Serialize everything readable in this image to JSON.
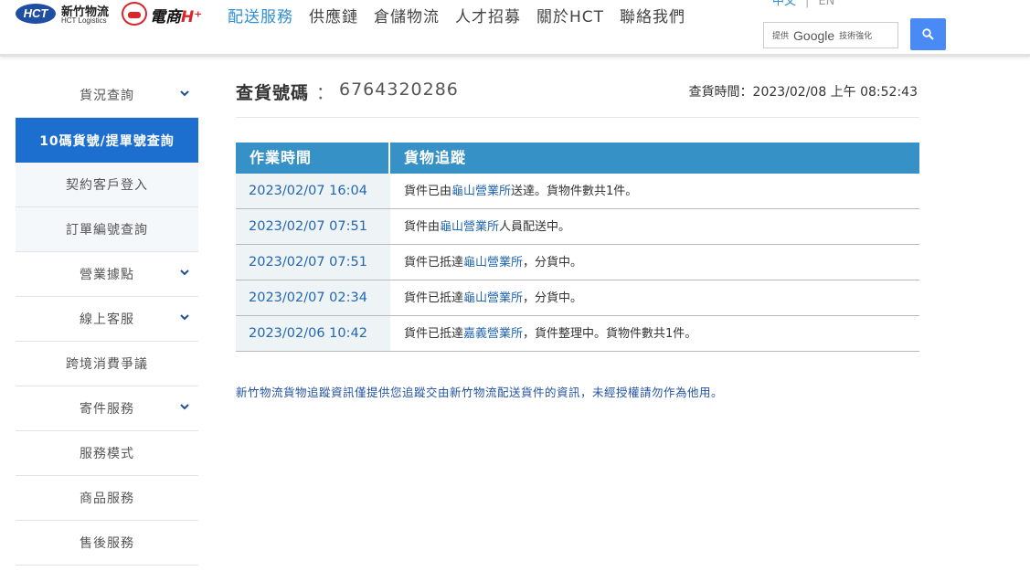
{
  "header": {
    "logo_hct": "HCT",
    "logo_cn": "新竹物流",
    "logo_en": "HCT Logistics",
    "logo_ds": "電商",
    "logo_ds_h": "H⁺",
    "nav": [
      {
        "label": "配送服務",
        "active": true
      },
      {
        "label": "供應鏈",
        "active": false
      },
      {
        "label": "倉儲物流",
        "active": false
      },
      {
        "label": "人才招募",
        "active": false
      },
      {
        "label": "關於HCT",
        "active": false
      },
      {
        "label": "聯絡我們",
        "active": false
      }
    ],
    "lang_zh": "中文",
    "lang_en": "EN",
    "search": {
      "by": "提供",
      "google": "Google",
      "tech": "技術強化"
    }
  },
  "sidebar": {
    "items": [
      {
        "label": "貨況查詢",
        "chevron": true
      },
      {
        "label": "10碼貨號/提單號查詢",
        "active": true
      },
      {
        "label": "契約客戶登入",
        "sub": true
      },
      {
        "label": "訂單編號查詢",
        "sub": true
      },
      {
        "label": "營業據點",
        "chevron": true
      },
      {
        "label": "線上客服",
        "chevron": true
      },
      {
        "label": "跨境消費爭議"
      },
      {
        "label": "寄件服務",
        "chevron": true
      },
      {
        "label": "服務模式"
      },
      {
        "label": "商品服務"
      },
      {
        "label": "售後服務"
      }
    ]
  },
  "main": {
    "title_label": "查貨號碼",
    "title_colon": "：",
    "tracking_number": "6764320286",
    "query_time": "查貨時間：2023/02/08 上午 08:52:43",
    "table": {
      "col_time": "作業時間",
      "col_track": "貨物追蹤",
      "rows": [
        {
          "time": "2023/02/07 16:04",
          "pre": "貨件已由",
          "loc": "龜山營業所",
          "post": "送達。貨物件數共1件。"
        },
        {
          "time": "2023/02/07 07:51",
          "pre": "貨件由",
          "loc": "龜山營業所",
          "post": "人員配送中。"
        },
        {
          "time": "2023/02/07 07:51",
          "pre": "貨件已抵達",
          "loc": "龜山營業所",
          "post": "，分貨中。"
        },
        {
          "time": "2023/02/07 02:34",
          "pre": "貨件已抵達",
          "loc": "龜山營業所",
          "post": "，分貨中。"
        },
        {
          "time": "2023/02/06 10:42",
          "pre": "貨件已抵達",
          "loc": "嘉義營業所",
          "post": "，貨件整理中。貨物件數共1件。"
        }
      ]
    },
    "disclaimer": "新竹物流貨物追蹤資訊僅提供您追蹤交由新竹物流配送貨件的資訊，未經授權請勿作為他用。"
  }
}
